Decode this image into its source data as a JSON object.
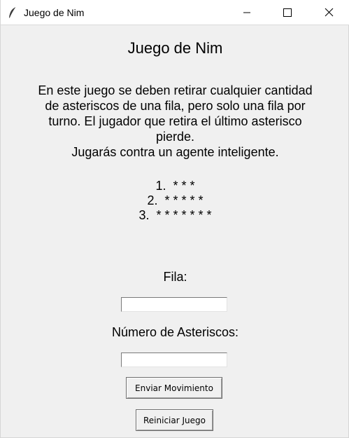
{
  "window": {
    "title": "Juego de Nim",
    "icon": "feather-icon"
  },
  "controls": {
    "minimize_icon": "minimize-icon",
    "maximize_icon": "maximize-icon",
    "close_icon": "close-icon"
  },
  "game": {
    "heading": "Juego de Nim",
    "rules": "En este juego se deben retirar cualquier cantidad\nde asteriscos de una fila, pero solo una fila por\nturno. El jugador que retira el último asterisco\npierde.\nJugarás contra un agente inteligente.",
    "rows": [
      "1.  * * *",
      "2.  * * * * *",
      "3.  * * * * * * *"
    ]
  },
  "form": {
    "row_label": "Fila:",
    "row_value": "",
    "count_label": "Número de Asteriscos:",
    "count_value": "",
    "send_button": "Enviar Movimiento",
    "reset_button": "Reiniciar Juego"
  }
}
